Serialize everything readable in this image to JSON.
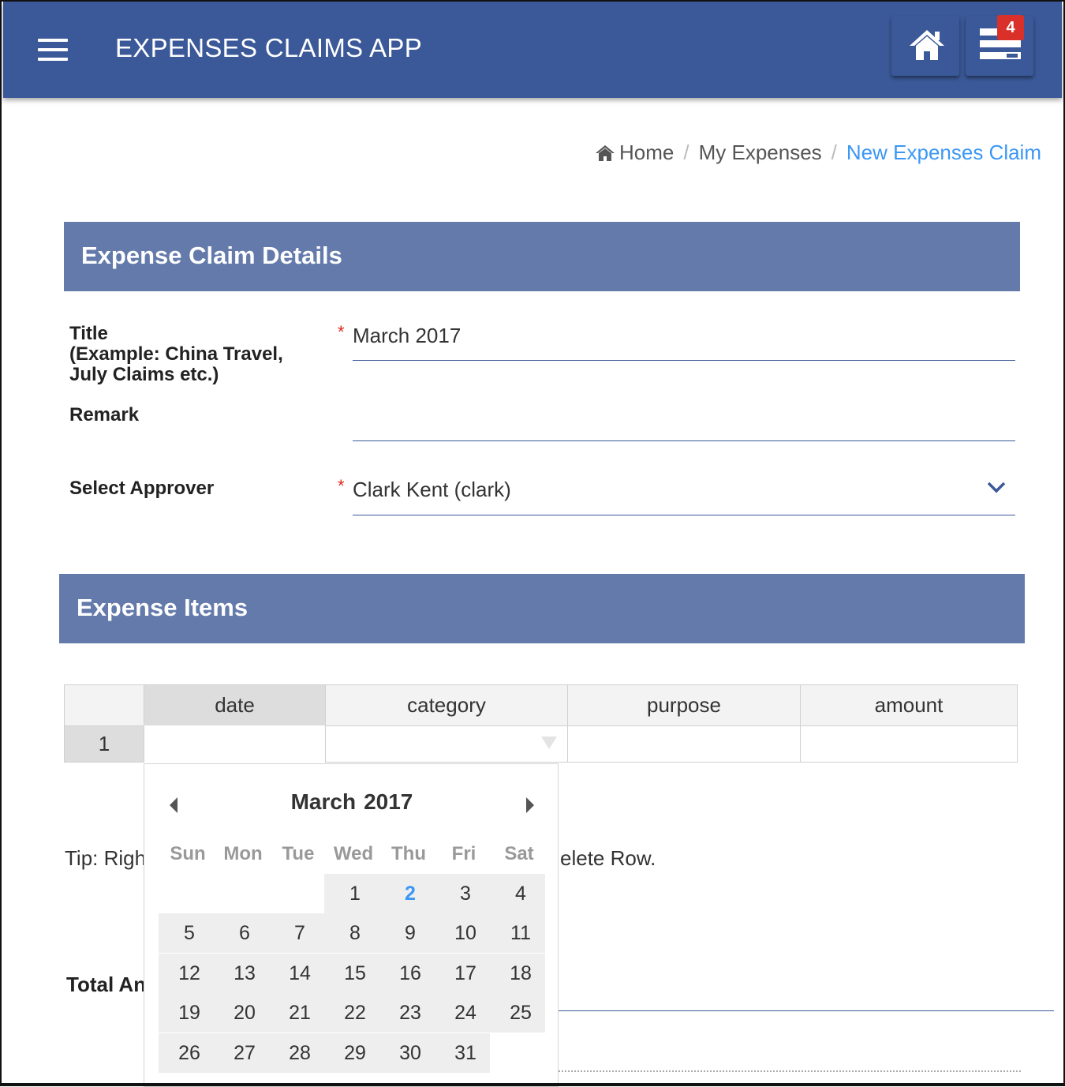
{
  "app": {
    "title": "EXPENSES CLAIMS APP",
    "notification_count": "4"
  },
  "breadcrumb": {
    "home": "Home",
    "my_expenses": "My Expenses",
    "current": "New Expenses Claim"
  },
  "claim_details": {
    "header": "Expense Claim Details",
    "title_label_1": "Title",
    "title_label_2": "(Example: China Travel,",
    "title_label_3": "July Claims etc.)",
    "title_value": "March 2017",
    "remark_label": "Remark",
    "remark_value": "",
    "approver_label": "Select Approver",
    "approver_value": "Clark Kent (clark)",
    "required_marker": "*"
  },
  "expense_items": {
    "header": "Expense Items",
    "columns": [
      "date",
      "category",
      "purpose",
      "amount"
    ],
    "rows": [
      {
        "row_number": "1",
        "date": "",
        "category": "",
        "purpose": "",
        "amount": ""
      }
    ],
    "tip_start": "Tip: Righ",
    "tip_end": "elete Row.",
    "total_label": "Total An"
  },
  "calendar": {
    "month": "March",
    "year": "2017",
    "weekdays": [
      "Sun",
      "Mon",
      "Tue",
      "Wed",
      "Thu",
      "Fri",
      "Sat"
    ],
    "first_weekday_index": 3,
    "days_in_month": 31,
    "highlighted_day": 2
  },
  "colors": {
    "primary": "#3b5998",
    "section_header": "#637aab",
    "link_active": "#3b97f5",
    "badge": "#d9302a",
    "required": "#e0261c"
  }
}
